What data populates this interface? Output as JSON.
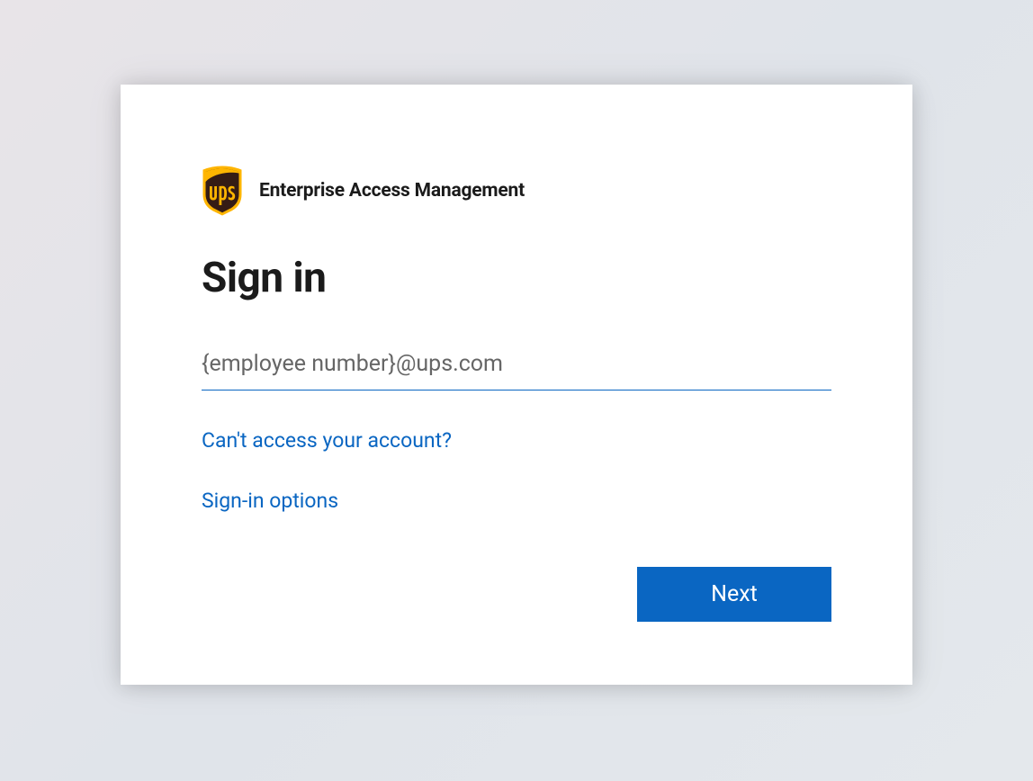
{
  "brand": {
    "logo_name": "ups-shield-logo",
    "product_name": "Enterprise Access Management"
  },
  "signin": {
    "title": "Sign in",
    "email_placeholder": "{employee number}@ups.com",
    "email_value": ""
  },
  "links": {
    "cant_access": "Can't access your account?",
    "signin_options": "Sign-in options"
  },
  "buttons": {
    "next": "Next"
  },
  "colors": {
    "primary": "#0a66c2",
    "ups_brown": "#351c15",
    "ups_gold": "#ffb500"
  }
}
